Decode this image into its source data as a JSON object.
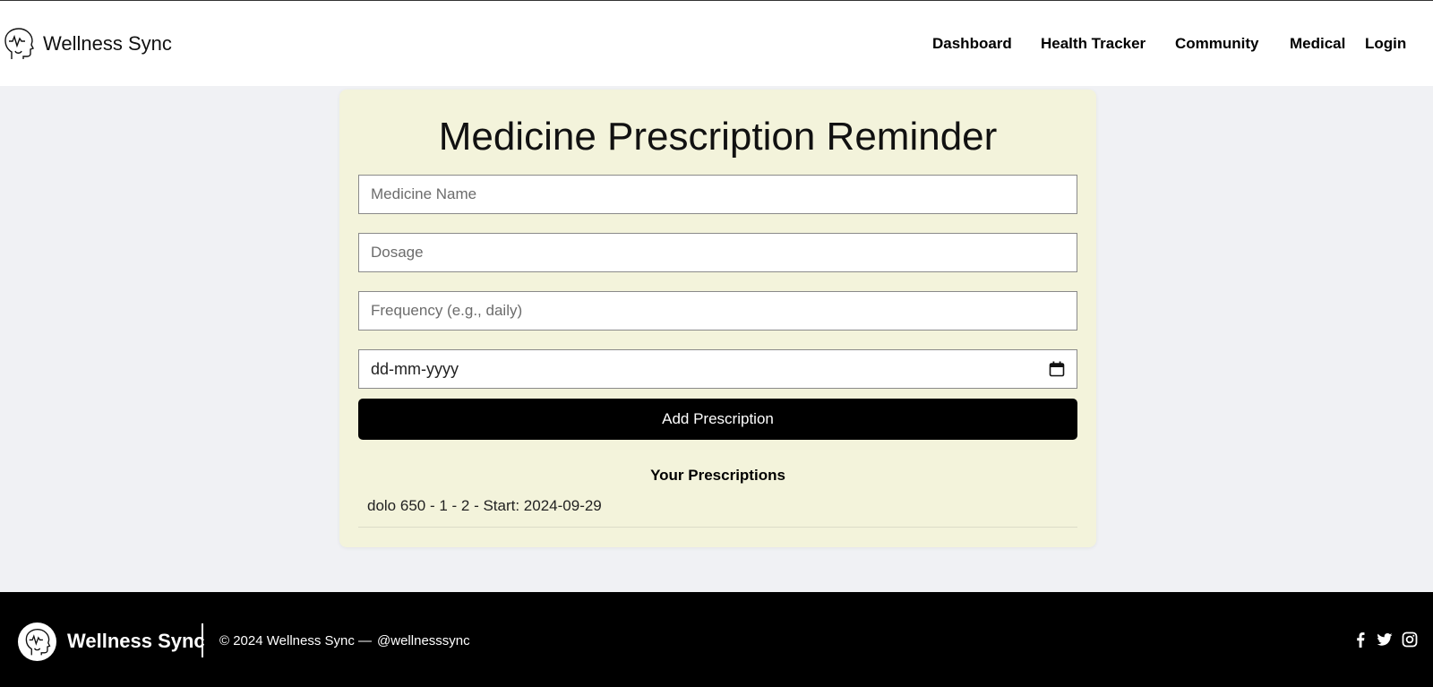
{
  "header": {
    "brand_name": "Wellness Sync",
    "logo_icon": "head-heartbeat-icon",
    "nav": [
      {
        "label": "Dashboard"
      },
      {
        "label": "Health Tracker"
      },
      {
        "label": "Community"
      },
      {
        "label": "Medical"
      },
      {
        "label": "Login"
      }
    ]
  },
  "form": {
    "title": "Medicine Prescription Reminder",
    "medicine_placeholder": "Medicine Name",
    "dosage_placeholder": "Dosage",
    "frequency_placeholder": "Frequency (e.g., daily)",
    "date_value": "dd-mm-yyyy",
    "date_icon": "calendar-icon",
    "submit_label": "Add Prescription"
  },
  "prescriptions": {
    "heading": "Your Prescriptions",
    "items": [
      {
        "text": "dolo 650 - 1 - 2 - Start: 2024-09-29"
      }
    ]
  },
  "footer": {
    "brand_name": "Wellness Sync",
    "copyright": "© 2024 Wellness Sync —",
    "handle": "@wellnesssync",
    "social_icons": [
      "facebook-icon",
      "twitter-icon",
      "instagram-icon"
    ]
  },
  "colors": {
    "page_bg": "#f0f1f4",
    "card_bg": "#f3f3db",
    "button_bg": "#000000",
    "footer_bg": "#000000"
  }
}
